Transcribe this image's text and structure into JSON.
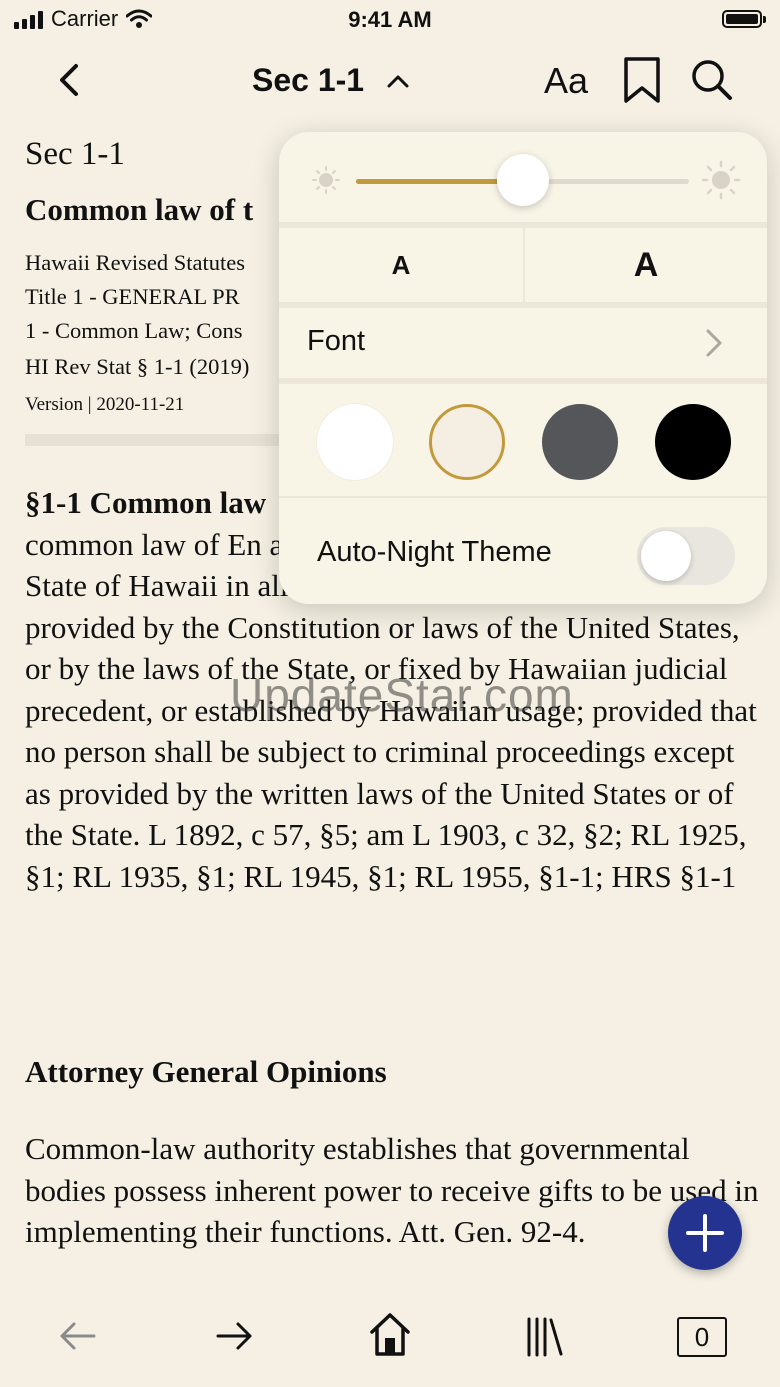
{
  "status_bar": {
    "carrier": "Carrier",
    "time": "9:41 AM"
  },
  "nav": {
    "title": "Sec 1-1",
    "font_button": "Aa",
    "icons": [
      "back-chevron-icon",
      "title-chevron-up-icon",
      "bookmark-icon",
      "search-icon"
    ]
  },
  "document": {
    "section_label": "Sec 1-1",
    "section_title": "Common law of t",
    "meta_lines": "Hawaii Revised Statutes\nTitle 1 - GENERAL PR\n1 - Common Law; Cons",
    "citation": "HI Rev Stat § 1-1 (2019)",
    "version": "Version | 2020-11-21",
    "body_heading": "§1-1 Common law",
    "body_text": "common law of En and American decis common law of the State of Hawaii in all cases, except as otherwise expressly provided by the Constitution or laws of the United States, or by the laws of the State, or fixed by Hawaiian judicial precedent, or established by Hawaiian usage; provided that no person shall be subject to criminal proceedings except as provided by the written laws of the United States or of the State. L 1892, c 57, §5; am L 1903, c 32, §2; RL 1925, §1; RL 1935, §1; RL 1945, §1; RL 1955, §1-1; HRS §1-1",
    "ag_heading": "Attorney General Opinions",
    "ag_text": "Common-law authority establishes that governmental bodies possess inherent power to receive gifts to be used in implementing their functions. Att. Gen. 92-4."
  },
  "watermark": "UpdateStar.com",
  "appearance_popover": {
    "brightness": 0.5,
    "font_size_small_label": "A",
    "font_size_large_label": "A",
    "font_label": "Font",
    "themes": [
      {
        "name": "white",
        "color": "#ffffff",
        "selected": false
      },
      {
        "name": "sepia",
        "color": "#f4efe2",
        "selected": true
      },
      {
        "name": "gray",
        "color": "#55565a",
        "selected": false
      },
      {
        "name": "night",
        "color": "#000000",
        "selected": false
      }
    ],
    "accent_color": "#c29a3c",
    "auto_night_label": "Auto-Night Theme",
    "auto_night_on": false
  },
  "fab_color": "#23338f",
  "toolbar": {
    "tab_count": "0",
    "icons": [
      "back-arrow-icon",
      "forward-arrow-icon",
      "home-icon",
      "library-icon"
    ]
  }
}
